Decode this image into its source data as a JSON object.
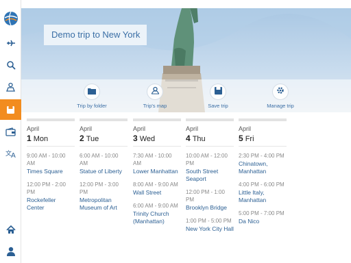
{
  "colors": {
    "accent": "#f28c1f",
    "link": "#2b5f93",
    "title": "#3a6ea5"
  },
  "sidebar": {
    "items": [
      {
        "icon": "app-logo-globe-icon",
        "active": false
      },
      {
        "icon": "airplane-icon",
        "active": false
      },
      {
        "icon": "search-icon",
        "active": false
      },
      {
        "icon": "map-person-icon",
        "active": false
      },
      {
        "icon": "saved-folder-icon",
        "active": true
      },
      {
        "icon": "ticket-wallet-icon",
        "active": false
      },
      {
        "icon": "translate-icon",
        "active": false
      },
      {
        "icon": "home-icon",
        "active": false
      },
      {
        "icon": "user-profile-icon",
        "active": false
      }
    ]
  },
  "hero": {
    "title": "Demo trip to New York"
  },
  "toolbar": {
    "items": [
      {
        "label": "Trip by folder",
        "icon": "folder-icon"
      },
      {
        "label": "Trip's map",
        "icon": "map-pin-icon"
      },
      {
        "label": "Save trip",
        "icon": "save-disk-icon"
      },
      {
        "label": "Manage trip",
        "icon": "gear-icon"
      }
    ]
  },
  "days": [
    {
      "month": "April",
      "num": "1",
      "weekday": "Mon",
      "slots": [
        {
          "time": "9:00 AM - 10:00 AM",
          "place": "Times Square"
        },
        {
          "time": "12:00 PM - 2:00 PM",
          "place": "Rockefeller Center"
        }
      ]
    },
    {
      "month": "April",
      "num": "2",
      "weekday": "Tue",
      "slots": [
        {
          "time": "6:00 AM - 10:00 AM",
          "place": "Statue of Liberty"
        },
        {
          "time": "12:00 PM - 3:00 PM",
          "place": "Metropolitan Museum of Art"
        }
      ]
    },
    {
      "month": "April",
      "num": "3",
      "weekday": "Wed",
      "slots": [
        {
          "time": "7:30 AM - 10:00 AM",
          "place": "Lower Manhattan"
        },
        {
          "time": "8:00 AM - 9:00 AM",
          "place": "Wall Street"
        },
        {
          "time": "6:00 AM - 9:00 AM",
          "place": "Trinity Church (Manhattan)"
        }
      ]
    },
    {
      "month": "April",
      "num": "4",
      "weekday": "Thu",
      "slots": [
        {
          "time": "10:00 AM - 12:00 PM",
          "place": "South Street Seaport"
        },
        {
          "time": "12:00 PM - 1:00 PM",
          "place": "Brooklyn Bridge"
        },
        {
          "time": "1:00 PM - 5:00 PM",
          "place": "New York City Hall"
        }
      ]
    },
    {
      "month": "April",
      "num": "5",
      "weekday": "Fri",
      "slots": [
        {
          "time": "2:30 PM - 4:00 PM",
          "place": "Chinatown, Manhattan"
        },
        {
          "time": "4:00 PM - 6:00 PM",
          "place": "Little Italy, Manhattan"
        },
        {
          "time": "5:00 PM - 7:00 PM",
          "place": "Da Nico"
        }
      ]
    }
  ]
}
